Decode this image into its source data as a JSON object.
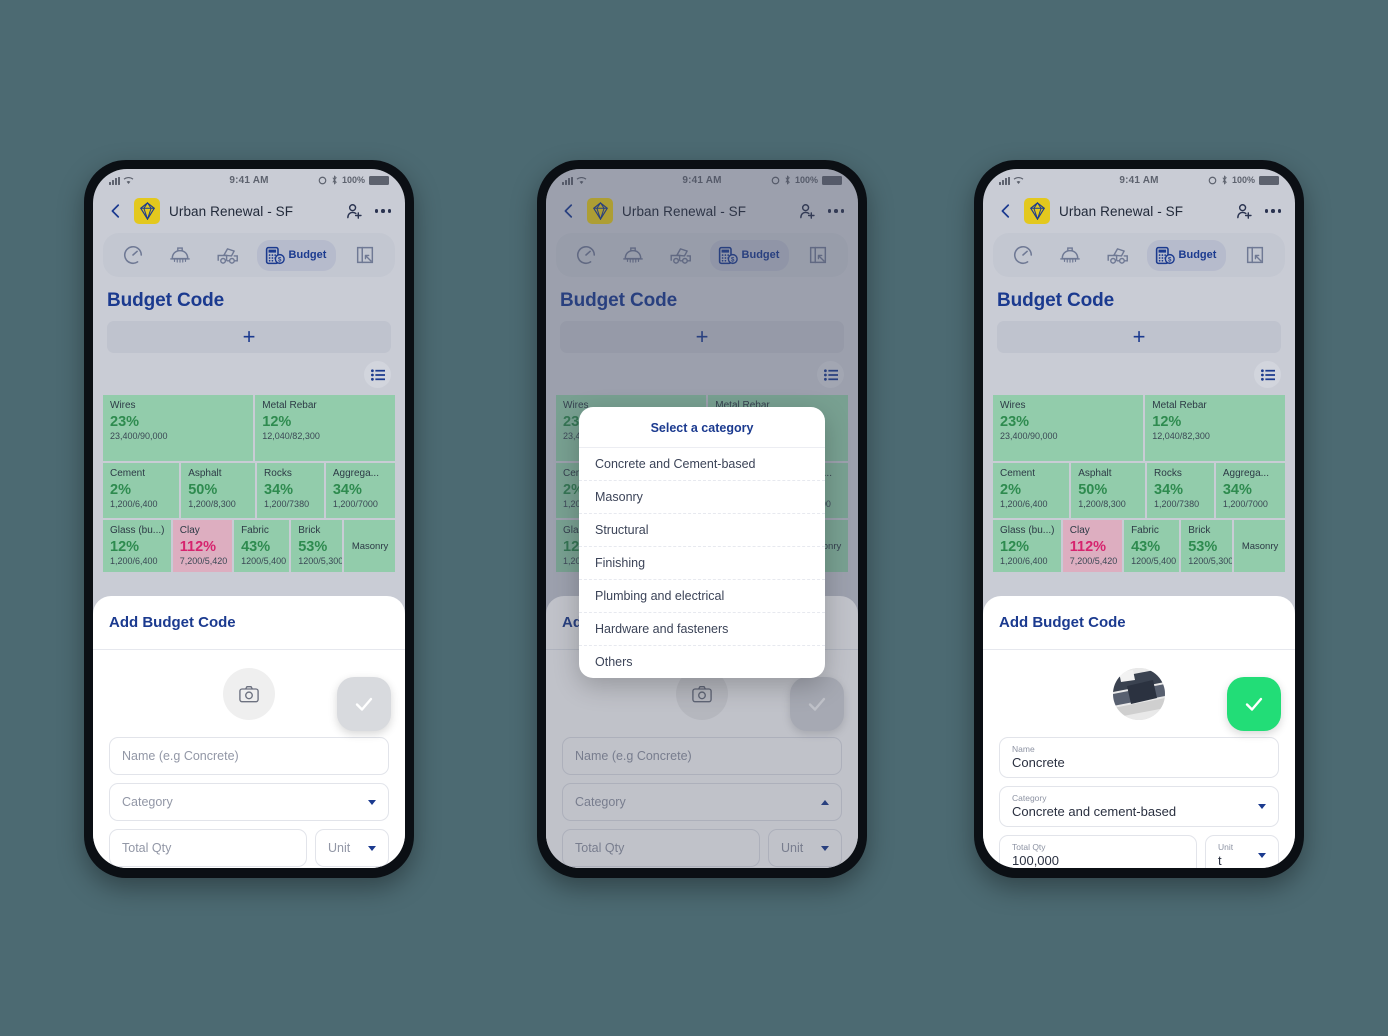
{
  "status_bar": {
    "time": "9:41 AM",
    "battery": "100%"
  },
  "appbar": {
    "title": "Urban Renewal - SF",
    "back_icon": "arrow-left-icon",
    "logo_icon": "diamond-logo-icon",
    "add_person_icon": "person-add-icon",
    "overflow_icon": "more-options-icon"
  },
  "tabs": [
    {
      "icon": "gauge-icon",
      "label": ""
    },
    {
      "icon": "hard-hat-icon",
      "label": ""
    },
    {
      "icon": "mixer-truck-icon",
      "label": ""
    },
    {
      "icon": "budget-calculator-icon",
      "label": "Budget",
      "active": true
    },
    {
      "icon": "blueprint-icon",
      "label": ""
    }
  ],
  "page": {
    "title": "Budget Code",
    "add_button_icon": "plus-icon",
    "list_view_icon": "list-view-icon"
  },
  "treemap": {
    "rows": [
      [
        {
          "name": "Wires",
          "pct": "23%",
          "sub": "23,400/90,000",
          "flex": 52,
          "tone": "green"
        },
        {
          "name": "Metal Rebar",
          "pct": "12%",
          "sub": "12,040/82,300",
          "flex": 48,
          "tone": "green"
        }
      ],
      [
        {
          "name": "Cement",
          "pct": "2%",
          "sub": "1,200/6,400",
          "flex": 27,
          "tone": "green"
        },
        {
          "name": "Asphalt",
          "pct": "50%",
          "sub": "1,200/8,300",
          "flex": 26,
          "tone": "green"
        },
        {
          "name": "Rocks",
          "pct": "34%",
          "sub": "1,200/7380",
          "flex": 23,
          "tone": "green"
        },
        {
          "name": "Aggrega...",
          "pct": "34%",
          "sub": "1,200/7000",
          "flex": 24,
          "tone": "green"
        }
      ],
      [
        {
          "name": "Glass (bu...)",
          "pct": "12%",
          "sub": "1,200/6,400",
          "flex": 26,
          "tone": "green"
        },
        {
          "name": "Clay",
          "pct": "112%",
          "sub": "7,200/5,420",
          "flex": 22,
          "tone": "pink"
        },
        {
          "name": "Fabric",
          "pct": "43%",
          "sub": "1200/5,400",
          "flex": 20,
          "tone": "green"
        },
        {
          "name": "Brick",
          "pct": "53%",
          "sub": "1200/5,300",
          "flex": 18,
          "tone": "green"
        },
        {
          "name": "Masonry",
          "pct": "",
          "sub": "",
          "flex": 18,
          "tone": "green",
          "plain": true
        }
      ]
    ]
  },
  "sheet": {
    "title": "Add Budget Code",
    "camera_icon": "camera-icon",
    "photo_icon": "photo-thumbnail",
    "fields": {
      "name_placeholder": "Name (e.g Concrete)",
      "name_label": "Name",
      "name_value": "Concrete",
      "category_placeholder": "Category",
      "category_label": "Category",
      "category_value": "Concrete and cement-based",
      "qty_placeholder": "Total Qty",
      "qty_label": "Total Qty",
      "qty_value": "100,000",
      "unit_placeholder": "Unit",
      "unit_label": "Unit",
      "unit_value": "t"
    },
    "fab_icon": "check-icon"
  },
  "category_modal": {
    "title": "Select a category",
    "options": [
      "Concrete and Cement-based",
      "Masonry",
      "Structural",
      "Finishing",
      "Plumbing and electrical",
      "Hardware and fasteners",
      "Others"
    ]
  },
  "colors": {
    "canvas": "#4c6a72",
    "screen_bg": "#c9ccd5",
    "navy": "#1b3a8f",
    "tile_green": "#92ccab",
    "tile_pink": "#ddaec0",
    "pct_green": "#2e8b4f",
    "pct_pink": "#d6246e",
    "fab_ready": "#22dd77",
    "fab_disabled": "#d8dade",
    "logo_yellow": "#e3c81e"
  }
}
